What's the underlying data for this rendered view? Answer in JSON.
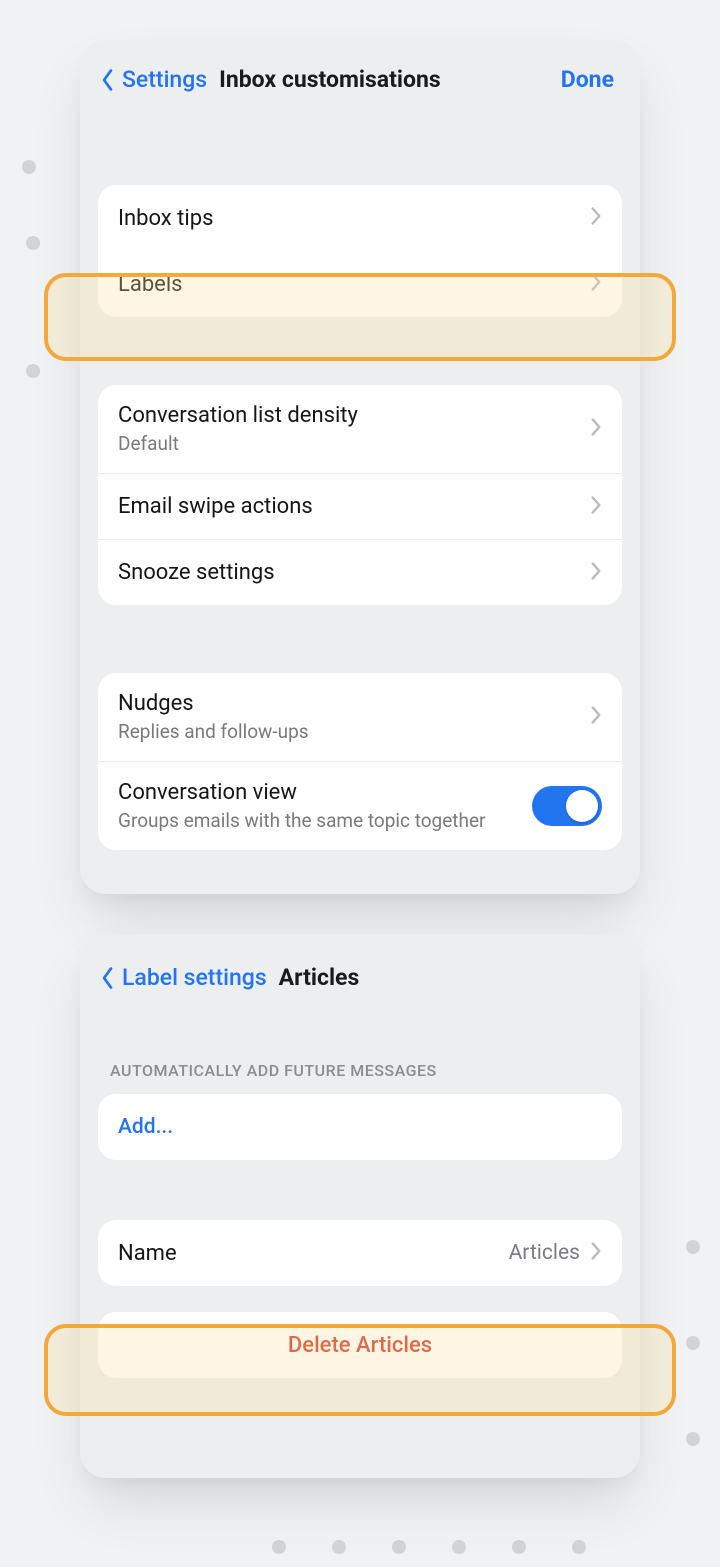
{
  "card1": {
    "back_label": "Settings",
    "title": "Inbox customisations",
    "done_label": "Done",
    "rows": {
      "inbox_tips": "Inbox tips",
      "labels": "Labels",
      "density_label": "Conversation list density",
      "density_value": "Default",
      "swipe": "Email swipe actions",
      "snooze": "Snooze settings",
      "nudges_label": "Nudges",
      "nudges_sub": "Replies and follow-ups",
      "conv_view_label": "Conversation view",
      "conv_view_sub": "Groups emails with the same topic together"
    }
  },
  "card2": {
    "back_label": "Label settings",
    "title": "Articles",
    "group_header": "AUTOMATICALLY ADD FUTURE MESSAGES",
    "add_label": "Add...",
    "name_label": "Name",
    "name_value": "Articles",
    "delete_label": "Delete Articles"
  }
}
